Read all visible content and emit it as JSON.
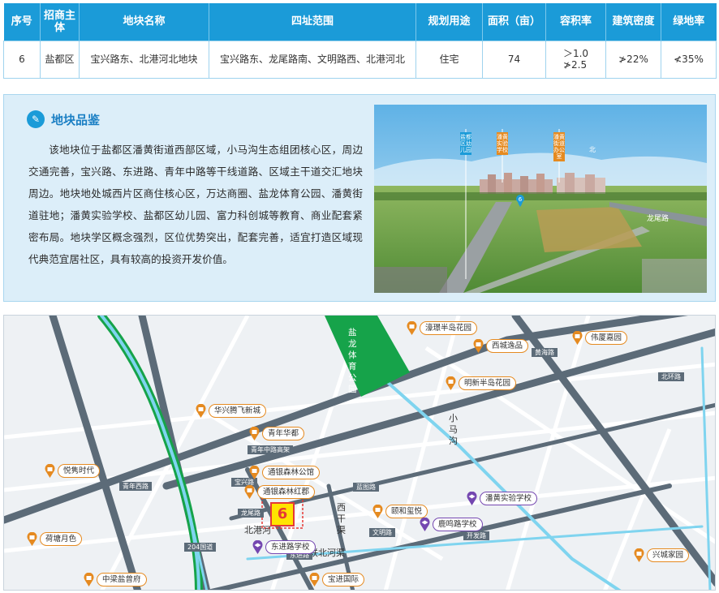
{
  "table": {
    "headers": [
      "序号",
      "招商主体",
      "地块名称",
      "四址范围",
      "规划用途",
      "面积（亩）",
      "容积率",
      "建筑密度",
      "绿地率"
    ],
    "row": {
      "index": "6",
      "district": "盐都区",
      "name": "宝兴路东、北港河北地块",
      "bounds": "宝兴路东、龙尾路南、文明路西、北港河北",
      "usage": "住宅",
      "area": "74",
      "far_1": "＞1.0",
      "far_2": "≯2.5",
      "density": "≯22%",
      "green": "≮35%"
    }
  },
  "intro": {
    "badge": "✎",
    "title": "地块品鉴",
    "text": "该地块位于盐都区潘黄街道西部区域，小马沟生态组团核心区，周边交通完善，宝兴路、东进路、青年中路等干线道路、区域主干道交汇地块周边。地块地处城西片区商住核心区，万达商圈、盐龙体育公园、潘黄街道驻地；潘黄实验学校、盐都区幼儿园、富力科创城等教育、商业配套紧密布局。地块学区概念强烈，区位优势突出，配套完善，适宜打造区域现代典范宜居社区，具有较高的投资开发价值。"
  },
  "photo": {
    "tags": [
      "盐都区幼儿园",
      "潘黄实验学校",
      "潘黄街道办公室"
    ],
    "marker": "6",
    "road": "龙尾路",
    "north": "北"
  },
  "map": {
    "site_number": "6",
    "park": "盐龙体育公园",
    "canal": "小马沟",
    "river_west": "西干渠",
    "river_north": "北港河",
    "river_lianbei": "联北河渠",
    "roads": {
      "qingnian_w": "青年西路",
      "qingnian_elev": "青年中路高架",
      "g204": "204国道",
      "baoxing": "宝兴路",
      "longwei": "龙尾路",
      "dongjin": "东进路",
      "lantu": "蓝图路",
      "wenming": "文明路",
      "huanghai": "黄海路",
      "kaifa": "开发路",
      "north_link": "北环路"
    },
    "pois": [
      {
        "name": "濠璟半岛花园",
        "type": "residential"
      },
      {
        "name": "西城逸品",
        "type": "residential"
      },
      {
        "name": "伟厦嘉园",
        "type": "residential"
      },
      {
        "name": "明新半岛花园",
        "type": "residential"
      },
      {
        "name": "华兴腾飞新城",
        "type": "residential"
      },
      {
        "name": "青年华都",
        "type": "residential"
      },
      {
        "name": "悦隽时代",
        "type": "residential"
      },
      {
        "name": "通银森林公馆",
        "type": "residential"
      },
      {
        "name": "通银森林红郡",
        "type": "residential"
      },
      {
        "name": "潘黄实验学校",
        "type": "school"
      },
      {
        "name": "颐和玺悦",
        "type": "residential"
      },
      {
        "name": "鹿鸣路学校",
        "type": "school"
      },
      {
        "name": "荷塘月色",
        "type": "residential"
      },
      {
        "name": "东进路学校",
        "type": "school"
      },
      {
        "name": "兴城家园",
        "type": "residential"
      },
      {
        "name": "中梁盐曾府",
        "type": "residential"
      },
      {
        "name": "宝进国际",
        "type": "residential"
      }
    ]
  },
  "colors": {
    "header": "#1b9bd8",
    "panel": "#dceef9",
    "park": "#16a34a",
    "road": "#5c6b78",
    "poi_residential": "#e58a20",
    "poi_school": "#7447b0",
    "site": "#ffe400"
  }
}
